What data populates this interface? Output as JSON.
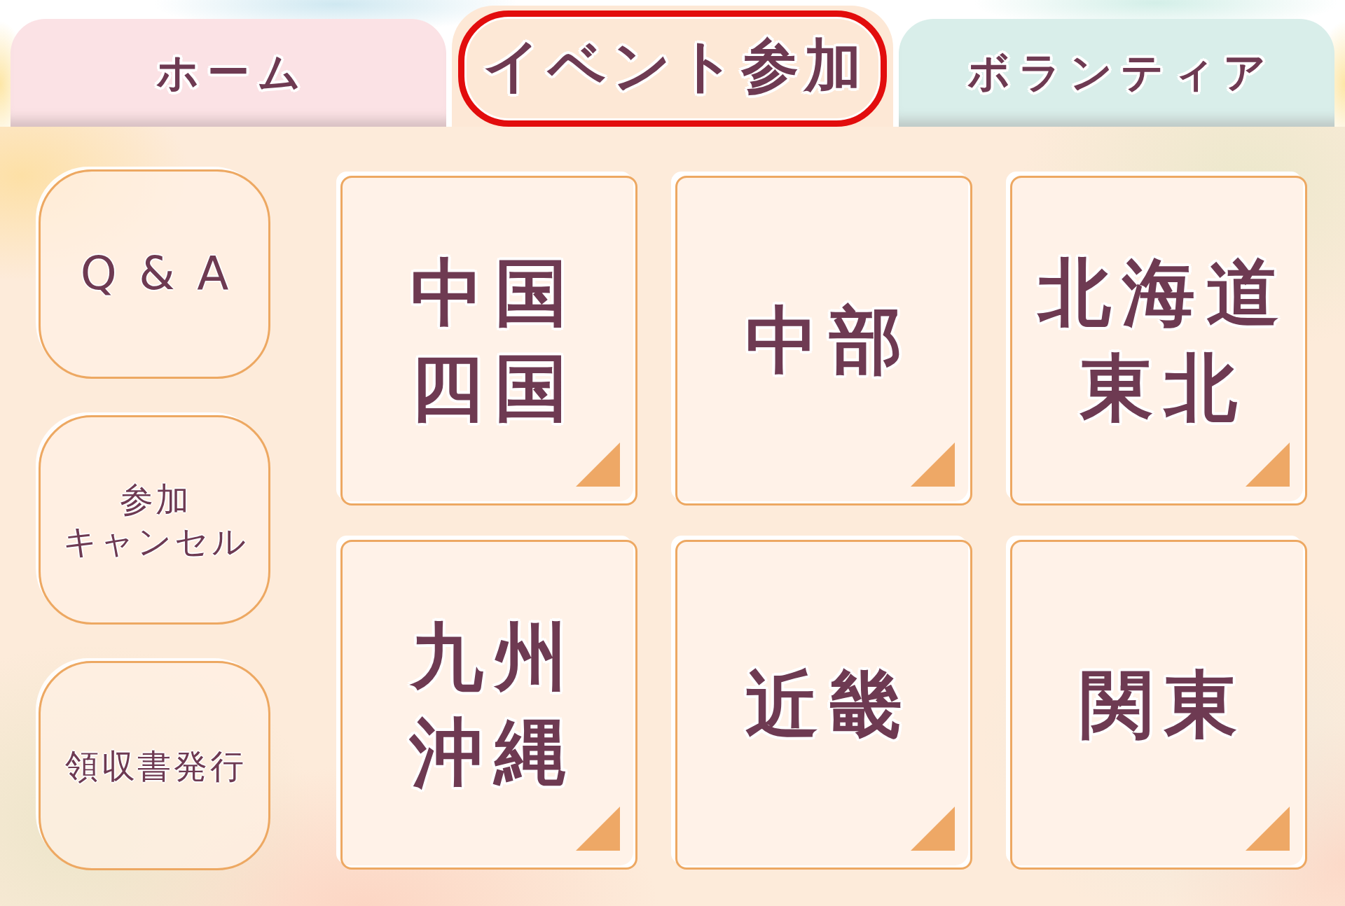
{
  "tabs": [
    {
      "label": "ホーム",
      "selected": false,
      "color": "#fbe2e5"
    },
    {
      "label": "イベント参加",
      "selected": true,
      "color": "#fde8d6"
    },
    {
      "label": "ボランティア",
      "selected": false,
      "color": "#d9eeea"
    }
  ],
  "menu_buttons": [
    {
      "lines": [
        "Q & A"
      ]
    },
    {
      "lines": [
        "参加",
        "キャンセル"
      ]
    },
    {
      "lines": [
        "領収書発行"
      ]
    }
  ],
  "region_cards": [
    {
      "lines": [
        "中国",
        "四国"
      ]
    },
    {
      "lines": [
        "中部"
      ]
    },
    {
      "lines": [
        "北海道",
        "東北"
      ]
    },
    {
      "lines": [
        "九州",
        "沖縄"
      ]
    },
    {
      "lines": [
        "近畿"
      ]
    },
    {
      "lines": [
        "関東"
      ]
    }
  ]
}
